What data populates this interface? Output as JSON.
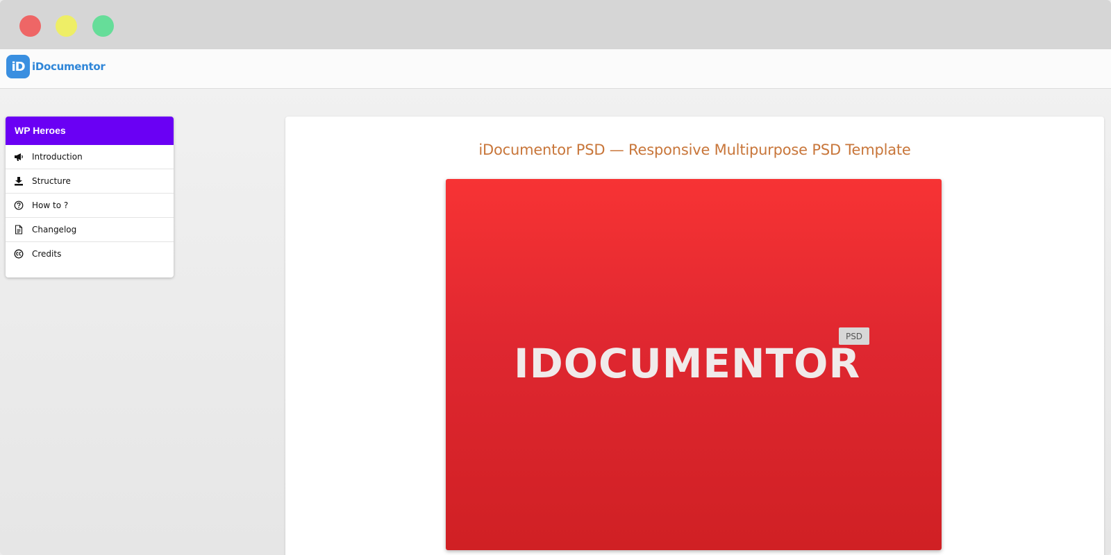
{
  "window": {
    "controls": [
      "close",
      "minimize",
      "maximize"
    ]
  },
  "header": {
    "logo_mark": "iD",
    "logo_text": "iDocumentor"
  },
  "sidebar": {
    "title": "WP Heroes",
    "items": [
      {
        "label": "Introduction",
        "icon": "megaphone-icon"
      },
      {
        "label": "Structure",
        "icon": "download-icon"
      },
      {
        "label": "How to ?",
        "icon": "question-circle-icon"
      },
      {
        "label": "Changelog",
        "icon": "document-icon"
      },
      {
        "label": "Credits",
        "icon": "creative-commons-icon"
      }
    ],
    "accent_color": "#6a00f4"
  },
  "main": {
    "title": "iDocumentor PSD — Responsive Multipurpose PSD Template",
    "title_color": "#c8763a",
    "hero": {
      "word": "IDOCUMENTOR",
      "badge": "PSD",
      "color": "#e0282f"
    }
  }
}
